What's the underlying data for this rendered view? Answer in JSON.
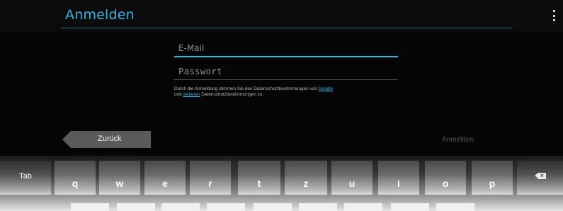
{
  "header": {
    "title": "Anmelden"
  },
  "form": {
    "email_placeholder": "E-Mail",
    "password_placeholder": "Passwort",
    "privacy": {
      "text_1": "Durch die Anmeldung stimmen Sie den Datenschutzbestimmungen von ",
      "link_google": "Google",
      "text_2": "und ",
      "link_weitere": "weiteren",
      "text_3": " Datenschutzbestimmungen zu."
    }
  },
  "nav": {
    "back_label": "Zurück",
    "login_label": "Anmelden"
  },
  "keyboard": {
    "tab_label": "Tab",
    "keys": [
      "q",
      "w",
      "e",
      "r",
      "t",
      "z",
      "u",
      "i",
      "o",
      "p"
    ],
    "backspace_icon": "backspace-icon"
  },
  "colors": {
    "accent": "#33b5e5",
    "background": "#050505",
    "back_button": "#5a5a5a"
  }
}
